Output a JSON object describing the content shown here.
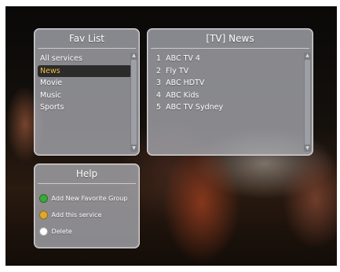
{
  "fav_list": {
    "title": "Fav List",
    "items": [
      {
        "label": "All services",
        "selected": false
      },
      {
        "label": "News",
        "selected": true
      },
      {
        "label": "Movie",
        "selected": false
      },
      {
        "label": "Music",
        "selected": false
      },
      {
        "label": "Sports",
        "selected": false
      }
    ]
  },
  "channels": {
    "title": "[TV]  News",
    "items": [
      {
        "number": "1",
        "name": "ABC TV 4"
      },
      {
        "number": "2",
        "name": "Fly TV"
      },
      {
        "number": "3",
        "name": "ABC HDTV"
      },
      {
        "number": "4",
        "name": "ABC Kids"
      },
      {
        "number": "5",
        "name": "ABC TV Sydney"
      }
    ]
  },
  "help": {
    "title": "Help",
    "items": [
      {
        "label": "Add New Favorite Group",
        "color": "#3aa83a",
        "icon": "green-button-icon"
      },
      {
        "label": "Add this service",
        "color": "#e0a82a",
        "icon": "yellow-button-icon"
      },
      {
        "label": "Delete",
        "color": "#ffffff",
        "icon": "white-button-icon"
      }
    ]
  },
  "colors": {
    "selected_text": "#f0c040",
    "selected_bg": "#2b2b2b"
  }
}
